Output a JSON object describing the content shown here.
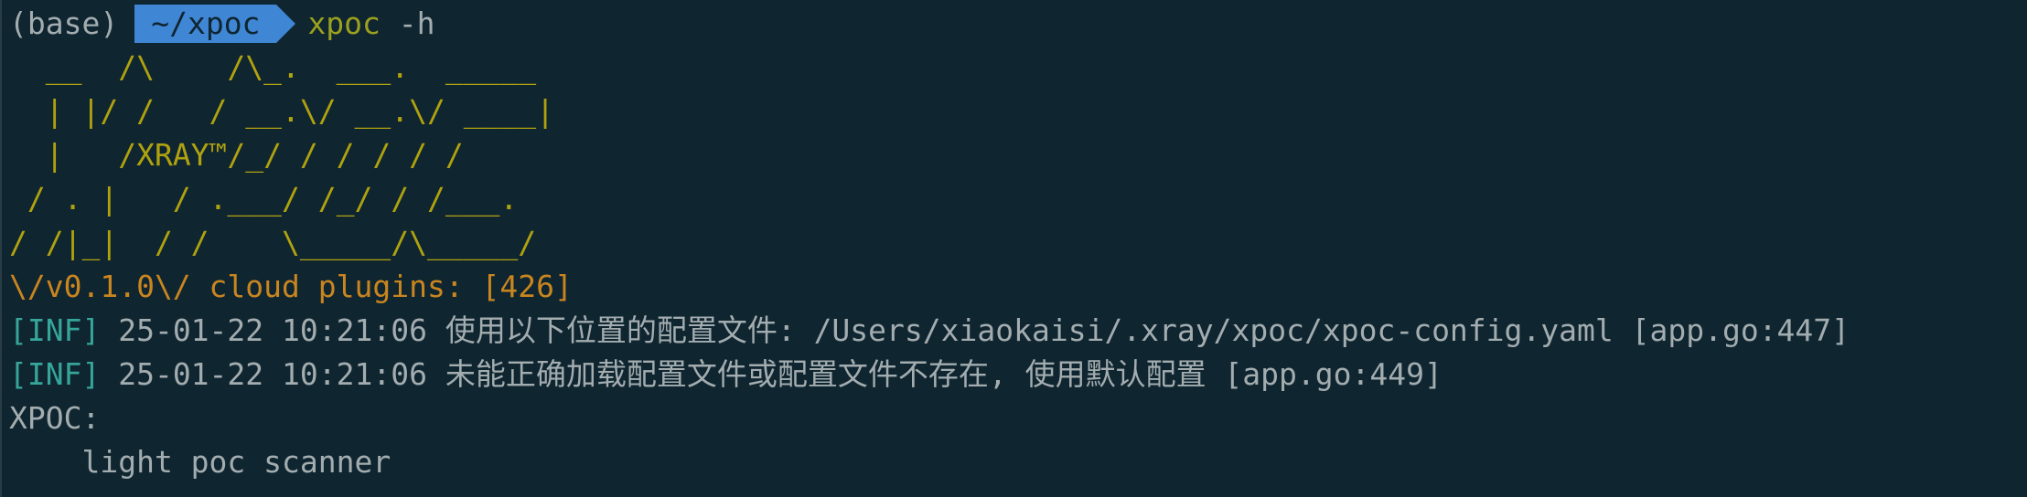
{
  "prompt": {
    "env": "(base)",
    "dir": "~/xpoc",
    "command": "xpoc",
    "args": "-h"
  },
  "banner": {
    "lines": [
      "  __  /\\    /\\_.  ___.  _____",
      "  | |/ /   / __.\\/ __.\\/ ____|",
      "  |   /XRAY™/_/ / / / / /",
      " / . |   / .___/ /_/ / /___.",
      "/ /|_|  / /    \\_____/\\_____/"
    ],
    "version_line": "\\/v0.1.0\\/ cloud plugins: [426]"
  },
  "logs": [
    {
      "level": "[INF]",
      "text": " 25-01-22 10:21:06 使用以下位置的配置文件: /Users/xiaokaisi/.xray/xpoc/xpoc-config.yaml [app.go:447]"
    },
    {
      "level": "[INF]",
      "text": " 25-01-22 10:21:06 未能正确加载配置文件或配置文件不存在, 使用默认配置 [app.go:449]"
    }
  ],
  "help": {
    "title": "XPOC:",
    "description": "    light poc scanner"
  },
  "colors": {
    "background": "#0f2530",
    "prompt_dir_bg": "#3f86d4",
    "ascii": "#b0a20f",
    "version": "#c9851f",
    "tag": "#36a69a",
    "text": "#a3adb0"
  }
}
